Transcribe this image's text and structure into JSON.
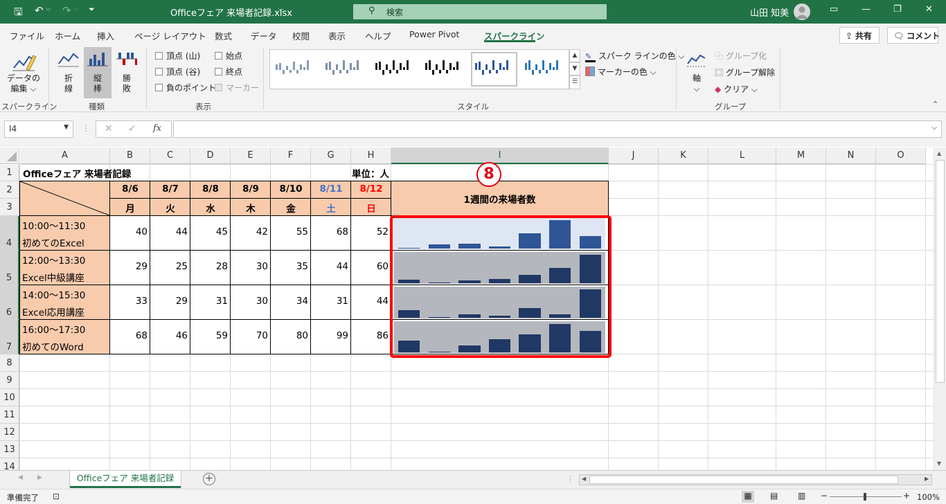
{
  "titlebar": {
    "filename": "Officeフェア 来場者記録.xlsx",
    "search_placeholder": "検索",
    "user": "山田 知美"
  },
  "tabs": [
    {
      "label": "ファイル"
    },
    {
      "label": "ホーム"
    },
    {
      "label": "挿入"
    },
    {
      "label": "ページ レイアウト"
    },
    {
      "label": "数式"
    },
    {
      "label": "データ"
    },
    {
      "label": "校閲"
    },
    {
      "label": "表示"
    },
    {
      "label": "ヘルプ"
    },
    {
      "label": "Power Pivot"
    },
    {
      "label": "スパークライン"
    }
  ],
  "header_buttons": {
    "share": "共有",
    "comment": "コメント"
  },
  "ribbon": {
    "edit_data": {
      "line1": "データの",
      "line2": "編集"
    },
    "types": {
      "line": "折\n線",
      "column": "縦\n棒",
      "winloss": "勝\n敗"
    },
    "show": {
      "high_point": "頂点 (山)",
      "low_point": "頂点 (谷)",
      "negative_points": "負のポイント",
      "first_point": "始点",
      "last_point": "終点",
      "markers": "マーカー"
    },
    "style_options": {
      "sparkline_color": "スパーク ラインの色",
      "marker_color": "マーカーの色"
    },
    "group_options": {
      "axis": "軸",
      "group": "グループ化",
      "ungroup": "グループ解除",
      "clear": "クリア"
    },
    "group_labels": {
      "sparkline": "スパークライン",
      "type": "種類",
      "show": "表示",
      "style": "スタイル",
      "group": "グループ"
    }
  },
  "formula_bar": {
    "name_box": "I4",
    "formula": ""
  },
  "columns": [
    "A",
    "B",
    "C",
    "D",
    "E",
    "F",
    "G",
    "H",
    "I",
    "J",
    "K",
    "L",
    "M",
    "N",
    "O"
  ],
  "rows": [
    "1",
    "2",
    "3",
    "4",
    "5",
    "6",
    "7",
    "8",
    "9",
    "10",
    "11",
    "12",
    "13",
    "14"
  ],
  "sheet": {
    "title": "Officeフェア 来場者記録",
    "unit": "単位：人",
    "sparkline_header": "1週間の来場者数",
    "dates": [
      "8/6",
      "8/7",
      "8/8",
      "8/9",
      "8/10",
      "8/11",
      "8/12"
    ],
    "weekdays": [
      "月",
      "火",
      "水",
      "木",
      "金",
      "土",
      "日"
    ],
    "sessions": [
      {
        "time": "10:00～11:30",
        "name": "初めてのExcel",
        "values": [
          40,
          44,
          45,
          42,
          55,
          68,
          52
        ]
      },
      {
        "time": "12:00～13:30",
        "name": "Excel中級講座",
        "values": [
          29,
          25,
          28,
          30,
          35,
          44,
          60
        ]
      },
      {
        "time": "14:00～15:30",
        "name": "Excel応用講座",
        "values": [
          33,
          29,
          31,
          30,
          34,
          31,
          44
        ]
      },
      {
        "time": "16:00～17:30",
        "name": "初めてのWord",
        "values": [
          68,
          46,
          59,
          70,
          80,
          99,
          86
        ]
      }
    ]
  },
  "step_badge": "8",
  "sheet_tab": "Officeフェア 来場者記録",
  "status": {
    "ready": "準備完了",
    "zoom": "100%"
  },
  "colors": {
    "accent": "#217346",
    "peach": "#f8cbad",
    "saturday": "#4472c4",
    "sunday": "#ff0000",
    "spark": "#2f5597",
    "highlight": "#ff0000"
  }
}
